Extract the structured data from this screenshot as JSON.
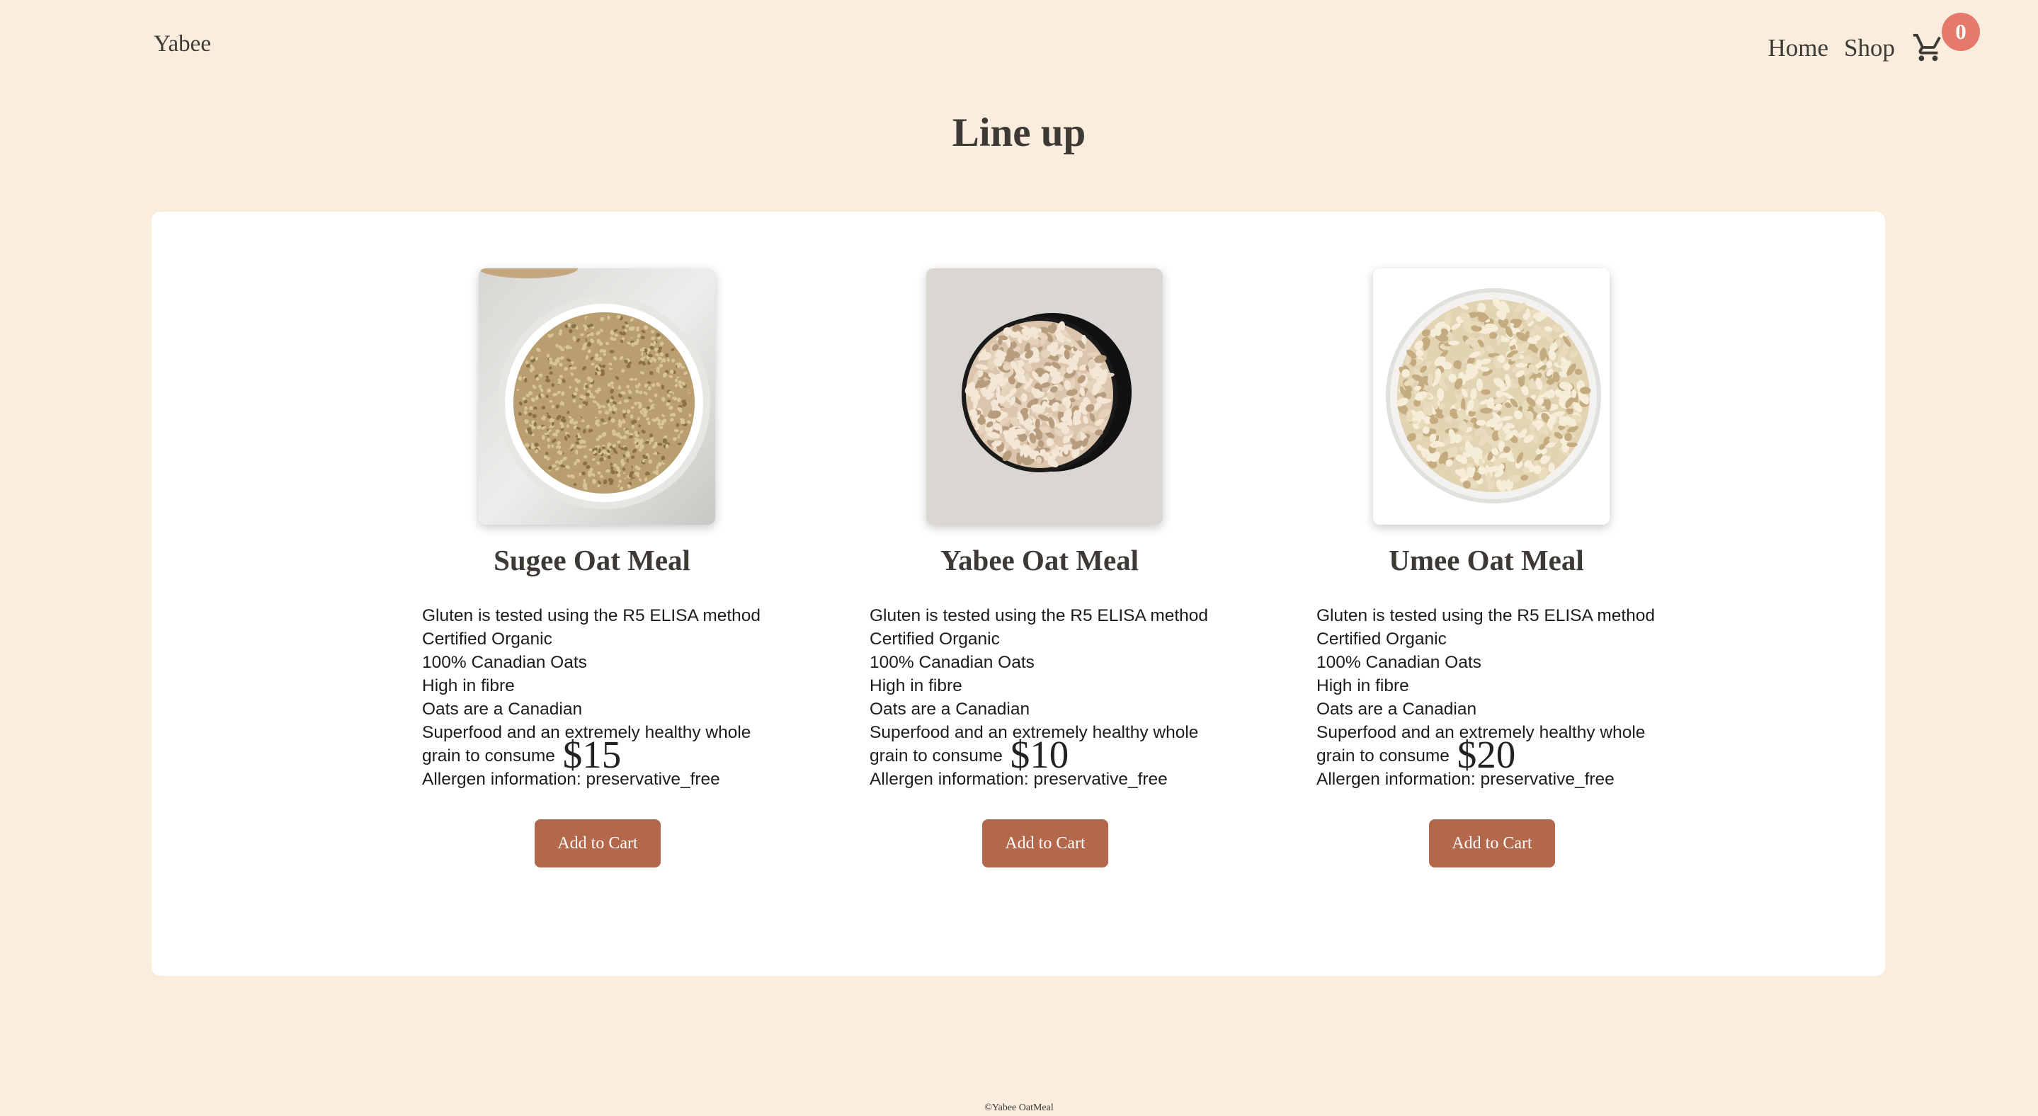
{
  "header": {
    "brand": "Yabee",
    "nav": {
      "home_label": "Home",
      "shop_label": "Shop",
      "cart_icon": "cart-icon",
      "cart_count": "0"
    }
  },
  "main": {
    "title": "Line up",
    "products": [
      {
        "name": "Sugee Oat Meal",
        "image": "steel-cut-oats-bowl",
        "description": [
          "Gluten is tested using the R5 ELISA method",
          "Certified Organic",
          "100% Canadian Oats",
          "High in fibre",
          "Oats are a Canadian",
          "Superfood and an extremely healthy whole grain to consume",
          "Allergen information: preservative_free"
        ],
        "price": "$15",
        "button_label": "Add to Cart"
      },
      {
        "name": "Yabee Oat Meal",
        "image": "rolled-oats-bowl-grey",
        "description": [
          "Gluten is tested using the R5 ELISA method",
          "Certified Organic",
          "100% Canadian Oats",
          "High in fibre",
          "Oats are a Canadian",
          "Superfood and an extremely healthy whole grain to consume",
          "Allergen information: preservative_free"
        ],
        "price": "$10",
        "button_label": "Add to Cart"
      },
      {
        "name": "Umee Oat Meal",
        "image": "rolled-oats-bowl-white",
        "description": [
          "Gluten is tested using the R5 ELISA method",
          "Certified Organic",
          "100% Canadian Oats",
          "High in fibre",
          "Oats are a Canadian",
          "Superfood and an extremely healthy whole grain to consume",
          "Allergen information: preservative_free"
        ],
        "price": "$20",
        "button_label": "Add to Cart"
      }
    ]
  },
  "footer": {
    "text": "©Yabee OatMeal"
  },
  "colors": {
    "background": "#faeddd",
    "panel": "#ffffff",
    "button": "#b4684b",
    "badge": "#e6796b",
    "text": "#3d3a36"
  }
}
